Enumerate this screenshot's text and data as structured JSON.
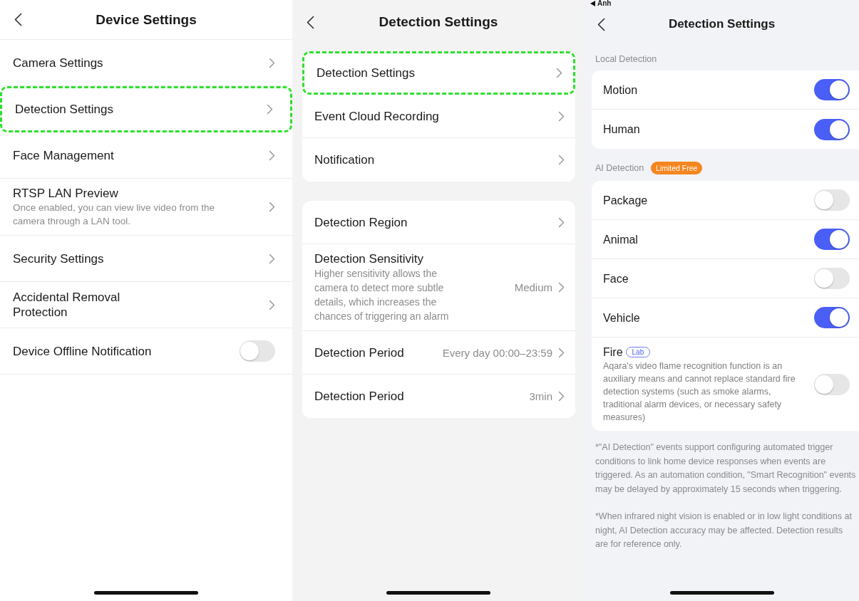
{
  "panels": [
    {
      "kind": "plain",
      "title": "Device Settings",
      "groups": [
        {
          "items": [
            {
              "label": "Camera Settings",
              "kind": "link",
              "highlighted": false
            },
            {
              "label": "Detection Settings",
              "kind": "link",
              "highlighted": true
            },
            {
              "label": "Face Management",
              "kind": "link",
              "highlighted": false
            },
            {
              "label": "RTSP LAN Preview",
              "description": "Once enabled, you can view live video from the camera through a LAN tool.",
              "kind": "link",
              "highlighted": false
            },
            {
              "label": "Security Settings",
              "kind": "link",
              "highlighted": false
            },
            {
              "label": "Accidental Removal Protection",
              "kind": "link",
              "highlighted": false
            },
            {
              "label": "Device Offline Notification",
              "kind": "toggle",
              "on": false,
              "highlighted": false
            }
          ]
        }
      ]
    },
    {
      "kind": "cards",
      "title": "Detection Settings",
      "groups": [
        {
          "items": [
            {
              "label": "Detection Settings",
              "kind": "link",
              "highlighted": true
            },
            {
              "label": "Event Cloud Recording",
              "kind": "link",
              "highlighted": false
            },
            {
              "label": "Notification",
              "kind": "link",
              "highlighted": false
            }
          ]
        },
        {
          "items": [
            {
              "label": "Detection Region",
              "kind": "link",
              "highlighted": false
            },
            {
              "label": "Detection Sensitivity",
              "description": "Higher sensitivity allows the camera to detect more subtle details, which increases the chances of triggering an alarm",
              "value": "Medium",
              "kind": "link",
              "highlighted": false
            },
            {
              "label": "Detection Period",
              "value": "Every day 00:00–23:59",
              "kind": "link",
              "highlighted": false
            },
            {
              "label": "Detection Period",
              "value": "3min",
              "kind": "link",
              "highlighted": false
            }
          ]
        }
      ]
    },
    {
      "kind": "sections",
      "status": "Anh",
      "title": "Detection Settings",
      "groups": [
        {
          "title": "Local Detection",
          "items": [
            {
              "label": "Motion",
              "kind": "toggle",
              "on": true,
              "highlighted": false
            },
            {
              "label": "Human",
              "kind": "toggle",
              "on": true,
              "highlighted": false
            }
          ]
        },
        {
          "title": "AI Detection",
          "badge": "Limited Free",
          "items": [
            {
              "label": "Package",
              "kind": "toggle",
              "on": false,
              "highlighted": false
            },
            {
              "label": "Animal",
              "kind": "toggle",
              "on": true,
              "highlighted": false
            },
            {
              "label": "Face",
              "kind": "toggle",
              "on": false,
              "highlighted": false
            },
            {
              "label": "Vehicle",
              "kind": "toggle",
              "on": true,
              "highlighted": false
            },
            {
              "label": "Fire",
              "tag": "Lab",
              "description": "Aqara's video flame recognition function is an auxiliary means and cannot replace standard fire detection systems (such as smoke alarms, traditional alarm devices, or necessary safety measures)",
              "kind": "toggle",
              "on": false,
              "highlighted": false
            }
          ]
        }
      ],
      "notes": [
        "*\"AI Detection\" events support configuring automated trigger conditions to link home device responses when events are triggered. As an automation condition, \"Smart Recognition\" events may be delayed by approximately 15 seconds when triggering.",
        "*When infrared night vision is enabled or in low light conditions at night, AI Detection accuracy may be affected. Detection results are for reference only."
      ]
    }
  ]
}
